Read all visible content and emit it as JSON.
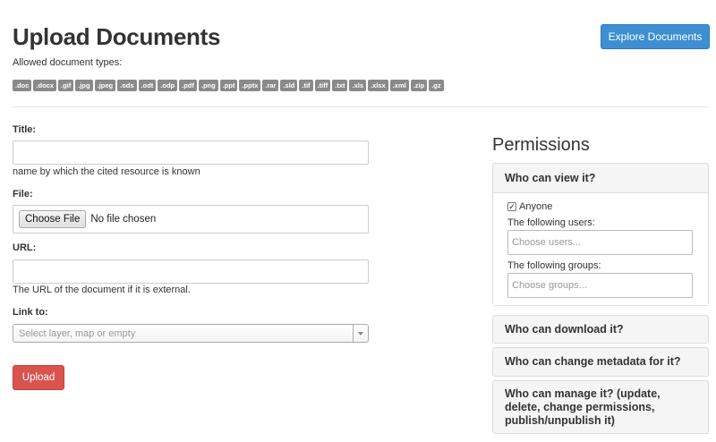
{
  "header": {
    "title": "Upload Documents",
    "explore_button": "Explore Documents",
    "allowed_label": "Allowed document types:",
    "types": [
      ".doc",
      ".docx",
      ".gif",
      ".jpg",
      ".jpeg",
      ".ods",
      ".odt",
      ".odp",
      ".pdf",
      ".png",
      ".ppt",
      ".pptx",
      ".rar",
      ".sld",
      ".tif",
      ".tiff",
      ".txt",
      ".xls",
      ".xlsx",
      ".xml",
      ".zip",
      ".gz"
    ]
  },
  "form": {
    "title_label": "Title:",
    "title_value": "",
    "title_help": "name by which the cited resource is known",
    "file_label": "File:",
    "choose_file_button": "Choose File",
    "no_file_text": "No file chosen",
    "url_label": "URL:",
    "url_value": "",
    "url_help": "The URL of the document if it is external.",
    "link_label": "Link to:",
    "link_placeholder": "Select layer, map or empty",
    "upload_button": "Upload"
  },
  "permissions": {
    "title": "Permissions",
    "view": {
      "heading": "Who can view it?",
      "anyone_label": "Anyone",
      "anyone_checked": true,
      "users_label": "The following users:",
      "users_placeholder": "Choose users...",
      "groups_label": "The following groups:",
      "groups_placeholder": "Choose groups..."
    },
    "download_heading": "Who can download it?",
    "metadata_heading": "Who can change metadata for it?",
    "manage_heading": "Who can manage it? (update, delete, change permissions, publish/unpublish it)"
  },
  "colors": {
    "primary_button": "#3d8fd1",
    "danger_button": "#d9534f",
    "badge": "#8a8a8a"
  }
}
